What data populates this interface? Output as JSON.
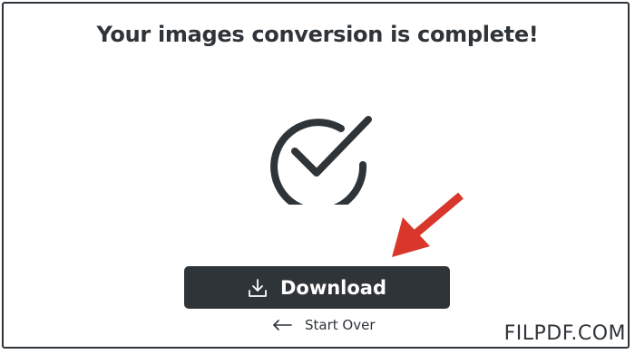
{
  "page": {
    "title": "Your images conversion is complete!"
  },
  "icons": {
    "success": "check-circle-icon",
    "pointer": "red-arrow-icon",
    "download": "download-icon",
    "back": "arrow-left-icon"
  },
  "actions": {
    "download_label": "Download",
    "start_over_label": "Start Over"
  },
  "watermark": {
    "text": "FILPDF.COM"
  },
  "colors": {
    "dark": "#2f3439",
    "arrow": "#d9372b",
    "background": "#ffffff",
    "button_text": "#ffffff"
  }
}
